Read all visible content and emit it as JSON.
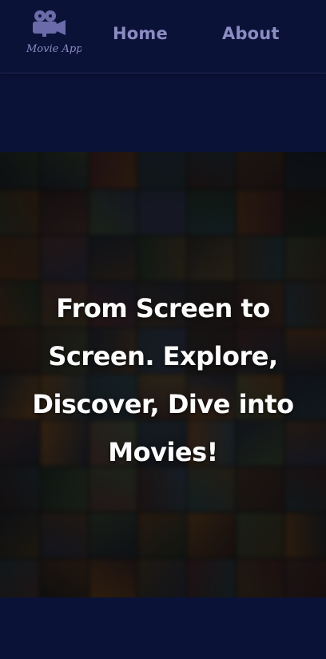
{
  "brand": {
    "logo_text": "Movie App",
    "icon": "film-camera-icon"
  },
  "nav": {
    "home_label": "Home",
    "about_label": "About"
  },
  "hero": {
    "title": "From Screen to Screen. Explore, Discover, Dive into Movies!",
    "background": "blurred-movie-poster-mosaic"
  },
  "colors": {
    "background": "#0b1238",
    "nav_text": "#8b8cc2",
    "hero_text": "#ffffff"
  }
}
